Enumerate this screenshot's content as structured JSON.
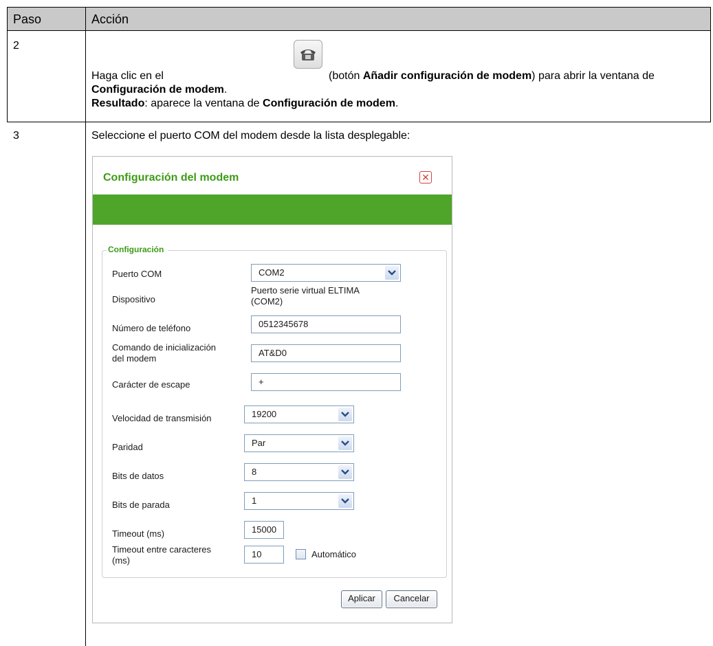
{
  "table": {
    "header": {
      "step_col": "Paso",
      "action_col": "Acción"
    },
    "rows": [
      {
        "step": "2",
        "line1_prefix": "Haga clic en el",
        "line1_paren_open": "(botón ",
        "line1_bold": "Añadir configuración de modem",
        "line1_suffix": ") para abrir la ventana de",
        "line2_bold": "Configuración de modem",
        "line2_suffix": ".",
        "line3_bold": "Resultado",
        "line3_mid": ": aparece la ventana de ",
        "line3_bold2": "Configuración de modem",
        "line3_suffix": "."
      },
      {
        "step": "3",
        "text": "Seleccione el puerto COM del modem desde la lista desplegable:"
      }
    ]
  },
  "dialog": {
    "title": "Configuración del modem",
    "close_symbol": "✕",
    "group_legend": "Configuración",
    "fields": {
      "com_port": {
        "label": "Puerto COM",
        "value": "COM2"
      },
      "device": {
        "label": "Dispositivo",
        "value_line1": "Puerto serie virtual ELTIMA",
        "value_line2": "(COM2)"
      },
      "phone": {
        "label": "Número de teléfono",
        "value": "0512345678"
      },
      "init_cmd": {
        "label_line1": "Comando de inicialización",
        "label_line2": "del modem",
        "value": "AT&D0"
      },
      "escape": {
        "label": "Carácter de escape",
        "value": "+"
      },
      "baud": {
        "label": "Velocidad de transmisión",
        "value": "19200"
      },
      "parity": {
        "label": "Paridad",
        "value": "Par"
      },
      "data_bits": {
        "label": "Bits de datos",
        "value": "8"
      },
      "stop_bits": {
        "label": "Bits de parada",
        "value": "1"
      },
      "timeout": {
        "label": "Timeout (ms)",
        "value": "15000"
      },
      "char_timeout": {
        "label_line1": "Timeout entre caracteres",
        "label_line2": "(ms)",
        "value": "10",
        "auto_label": "Automático",
        "auto_checked": false
      }
    },
    "buttons": {
      "apply": "Aplicar",
      "cancel": "Cancelar"
    }
  },
  "colors": {
    "accent_green": "#4fa52a",
    "title_green": "#3d9b15",
    "close_red": "#d3423a",
    "header_gray": "#c9c9c9"
  }
}
